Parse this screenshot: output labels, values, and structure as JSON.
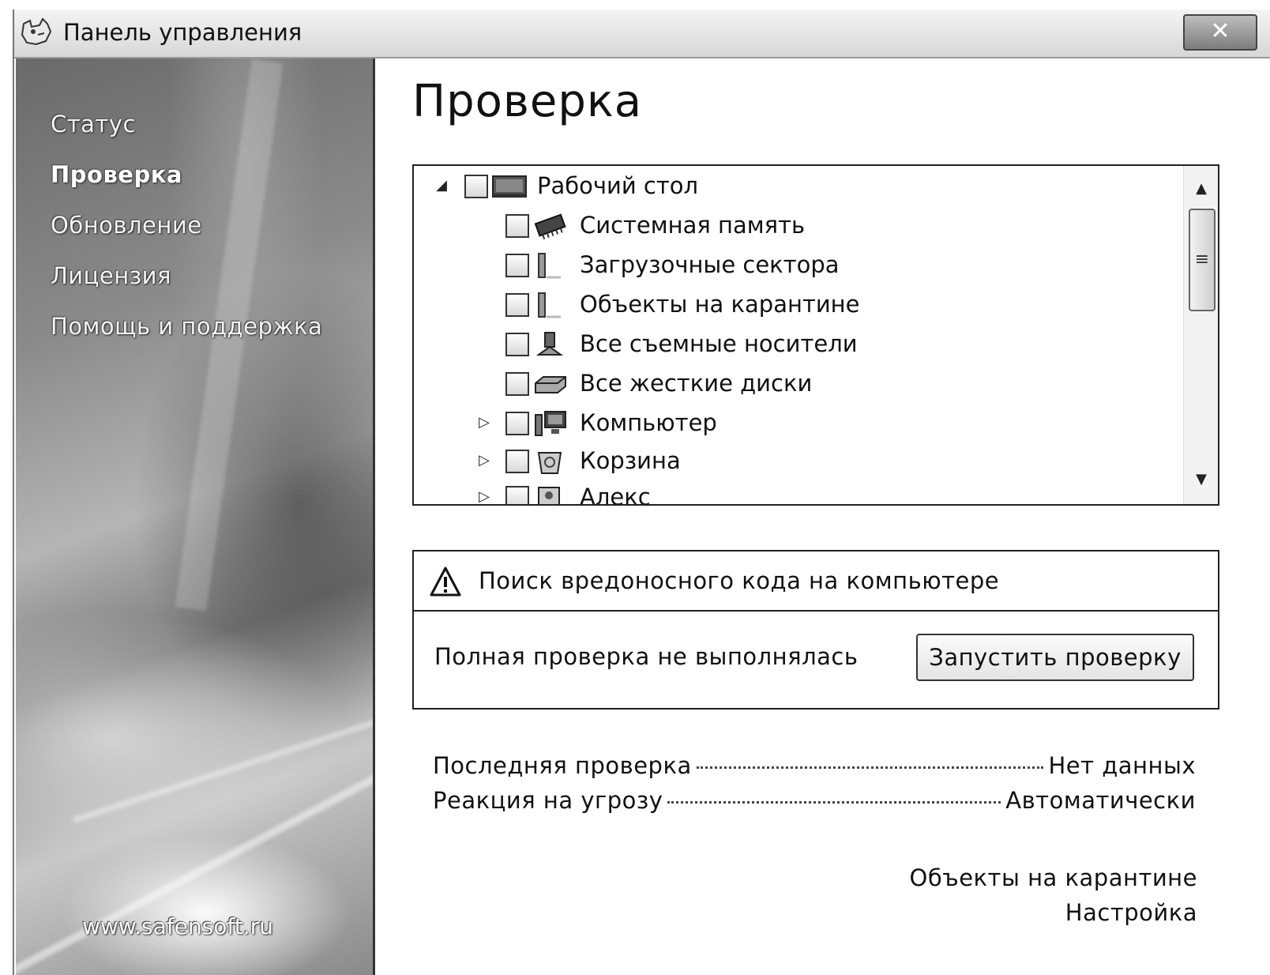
{
  "window": {
    "title": "Панель управления",
    "close_label": "✕"
  },
  "sidebar": {
    "items": [
      {
        "label": "Статус",
        "active": false
      },
      {
        "label": "Проверка",
        "active": true
      },
      {
        "label": "Обновление",
        "active": false
      },
      {
        "label": "Лицензия",
        "active": false
      },
      {
        "label": "Помощь и поддержка",
        "active": false
      }
    ],
    "footer_link": "www.safensoft.ru"
  },
  "main": {
    "title": "Проверка",
    "tree": {
      "root": {
        "label": "Рабочий стол",
        "expanded": true,
        "icon": "desktop-icon"
      },
      "items": [
        {
          "label": "Системная память",
          "icon": "memory-chip-icon"
        },
        {
          "label": "Загрузочные сектора",
          "icon": "boot-sector-icon"
        },
        {
          "label": "Объекты на карантине",
          "icon": "quarantine-icon"
        },
        {
          "label": "Все съемные носители",
          "icon": "removable-media-icon"
        },
        {
          "label": "Все жесткие диски",
          "icon": "hard-drive-icon"
        },
        {
          "label": "Компьютер",
          "icon": "computer-icon",
          "expandable": true
        },
        {
          "label": "Корзина",
          "icon": "recycle-bin-icon",
          "expandable": true
        },
        {
          "label": "Алекс",
          "icon": "user-folder-icon",
          "expandable": true
        }
      ]
    },
    "scan_box": {
      "header": "Поиск вредоносного кода на компьютере",
      "status": "Полная проверка не выполнялась",
      "button": "Запустить проверку"
    },
    "info": [
      {
        "label": "Последняя проверка",
        "value": "Нет данных"
      },
      {
        "label": "Реакция на угрозу",
        "value": "Автоматически"
      }
    ],
    "links": {
      "quarantine": "Объекты на карантине",
      "settings": "Настройка"
    }
  }
}
